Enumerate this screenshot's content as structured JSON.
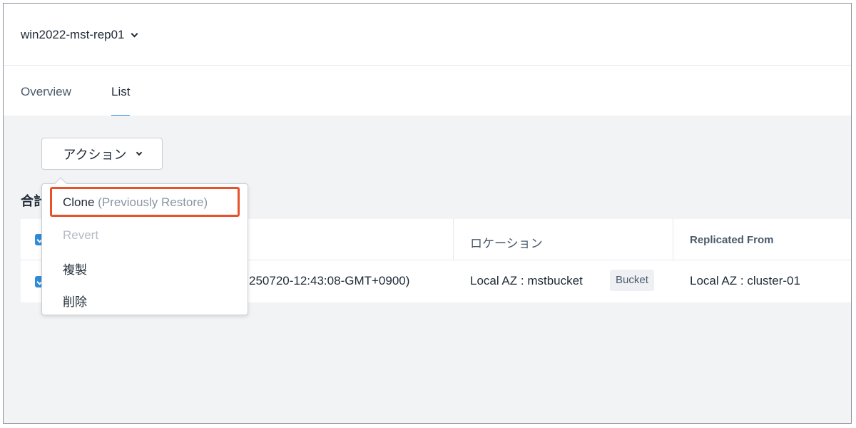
{
  "header": {
    "title": "win2022-mst-rep01"
  },
  "tabs": [
    {
      "label": "Overview",
      "active": false
    },
    {
      "label": "List",
      "active": true
    }
  ],
  "actions": {
    "button_label": "アクション",
    "menu": {
      "clone_label": "Clone",
      "clone_sub": "(Previously Restore)",
      "revert_label": "Revert",
      "duplicate_label": "複製",
      "delete_label": "削除"
    }
  },
  "summary": {
    "label": "合計"
  },
  "table": {
    "columns": {
      "location": "ロケーション",
      "replicated_from": "Replicated From"
    },
    "rows": [
      {
        "name_fragment": "250720-12:43:08-GMT+0900)",
        "location": "Local AZ : mstbucket",
        "location_badge": "Bucket",
        "replicated_from": "Local AZ : cluster-01"
      }
    ]
  },
  "colors": {
    "accent": "#2f8bd8",
    "highlight": "#e8512a",
    "muted": "#8a95a3",
    "disabled": "#b4bcc6",
    "content_bg": "#f2f3f5"
  },
  "icons": [
    "chevron-down-icon",
    "checkbox-checked-icon"
  ]
}
